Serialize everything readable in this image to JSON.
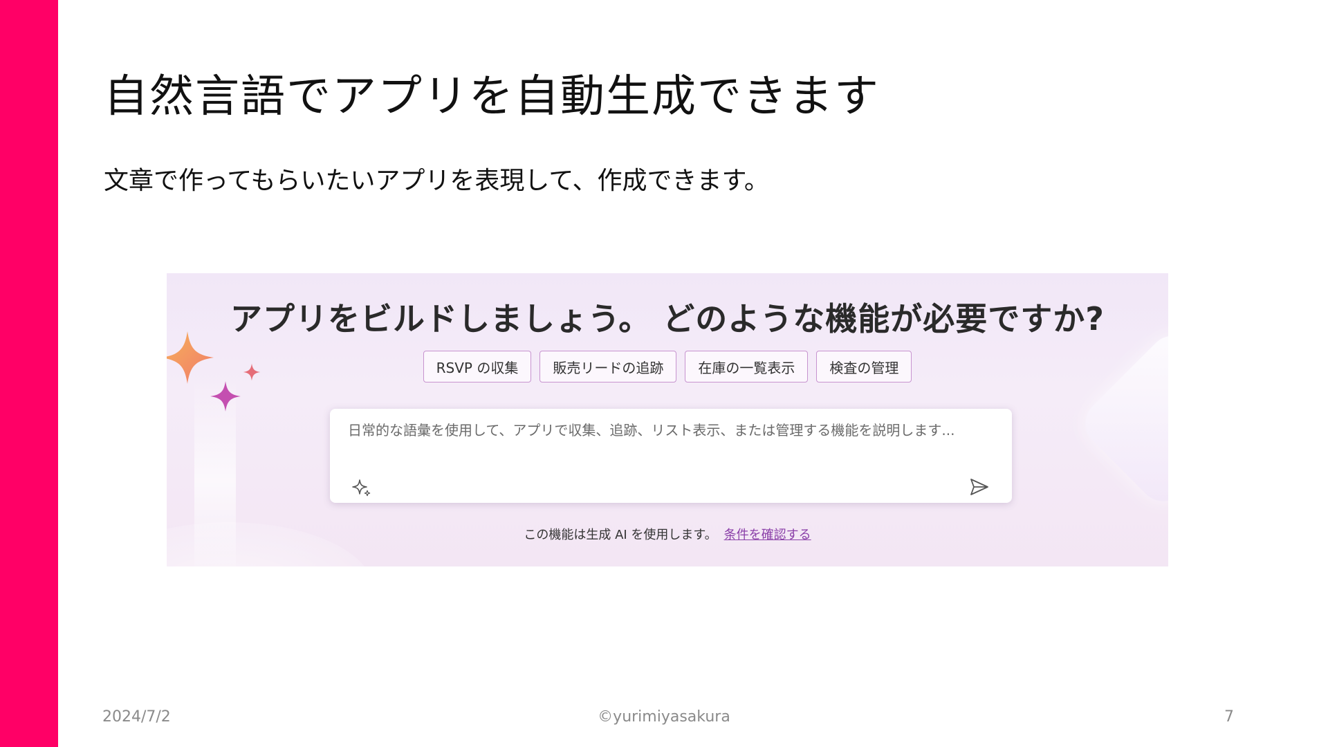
{
  "slide": {
    "title": "自然言語でアプリを自動生成できます",
    "subtitle": "文章で作ってもらいたいアプリを表現して、作成できます。",
    "accent_color": "#ff0066"
  },
  "screenshot": {
    "headline": "アプリをビルドしましょう。 どのような機能が必要ですか?",
    "chips": [
      {
        "label": "RSVP の収集"
      },
      {
        "label": "販売リードの追跡"
      },
      {
        "label": "在庫の一覧表示"
      },
      {
        "label": "検査の管理"
      }
    ],
    "prompt": {
      "placeholder": "日常的な語彙を使用して、アプリで収集、追跡、リスト表示、または管理する機能を説明します...",
      "value": "",
      "left_icon": "sparkle-icon",
      "right_icon": "send-icon"
    },
    "disclaimer_text": "この機能は生成 AI を使用します。",
    "terms_link": "条件を確認する",
    "link_color": "#8a3fa8"
  },
  "footer": {
    "date": "2024/7/2",
    "copyright": "©yurimiyasakura",
    "page_number": "7"
  }
}
